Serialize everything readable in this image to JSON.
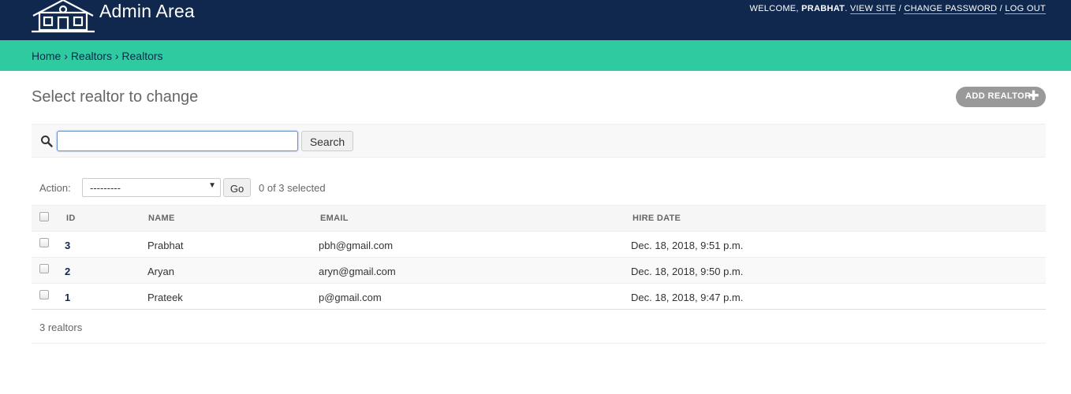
{
  "header": {
    "brand": "Admin Area",
    "welcome": "WELCOME,",
    "username": "PRABHAT",
    "view_site": "VIEW SITE",
    "change_password": "CHANGE PASSWORD",
    "log_out": "LOG OUT",
    "separator": "/"
  },
  "breadcrumbs": [
    "Home",
    "Realtors",
    "Realtors"
  ],
  "breadcrumb_sep": "›",
  "page": {
    "title": "Select realtor to change",
    "add_button": "ADD REALTOR"
  },
  "search": {
    "value": "",
    "button": "Search"
  },
  "actions": {
    "label": "Action:",
    "selected_option": "---------",
    "go": "Go",
    "selected_count": "0 of 3 selected"
  },
  "table": {
    "columns": [
      "ID",
      "NAME",
      "EMAIL",
      "HIRE DATE"
    ],
    "rows": [
      {
        "id": "3",
        "name": "Prabhat",
        "email": "pbh@gmail.com",
        "hire_date": "Dec. 18, 2018, 9:51 p.m."
      },
      {
        "id": "2",
        "name": "Aryan",
        "email": "aryn@gmail.com",
        "hire_date": "Dec. 18, 2018, 9:50 p.m."
      },
      {
        "id": "1",
        "name": "Prateek",
        "email": "p@gmail.com",
        "hire_date": "Dec. 18, 2018, 9:47 p.m."
      }
    ]
  },
  "paginator": "3 realtors",
  "colors": {
    "header_bg": "#10284e",
    "breadcrumb_bg": "#30caa0",
    "add_button_bg": "#999999"
  }
}
